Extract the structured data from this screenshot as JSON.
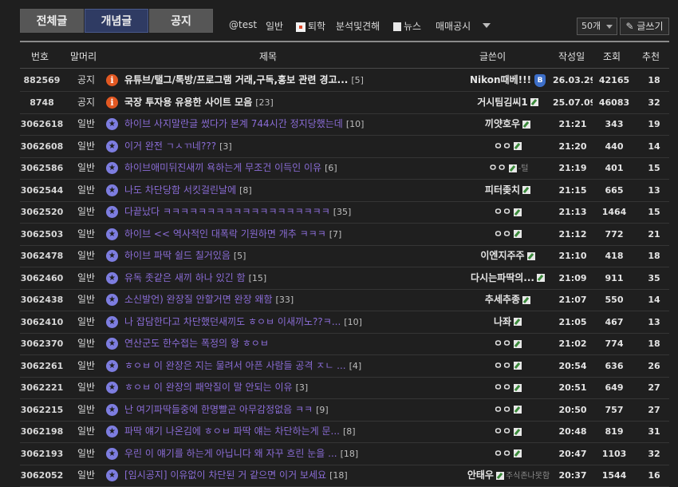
{
  "tabs": [
    {
      "label": "전체글"
    },
    {
      "label": "개념글"
    },
    {
      "label": "공지"
    }
  ],
  "categories": [
    {
      "label": "@test"
    },
    {
      "label": "일반"
    },
    {
      "label": "퇴학"
    },
    {
      "label": "분석및견해"
    },
    {
      "label": "뉴스"
    },
    {
      "label": "매매공시"
    }
  ],
  "page_size": {
    "value": "50개"
  },
  "write_button": {
    "label": "글쓰기"
  },
  "columns": {
    "num": "번호",
    "head": "말머리",
    "title": "제목",
    "writer": "글쓴이",
    "date": "작성일",
    "views": "조회",
    "rec": "추천"
  },
  "posts": [
    {
      "num": "882569",
      "head": "공지",
      "title": "유튜브/탤그/톡방/프로그램 거래,구독,홍보 관련 경고...",
      "count": "[5]",
      "writer": "Nikon때베!!!",
      "writer_sub": "",
      "date": "26.03.29",
      "views": "42165",
      "rec": "18",
      "notice": true
    },
    {
      "num": "8748",
      "head": "공지",
      "title": "국장 투자용 유용한 사이트 모음",
      "count": "[23]",
      "writer": "거시팀김씨1",
      "writer_sub": "",
      "date": "25.07.09",
      "views": "46083",
      "rec": "32",
      "notice": true
    },
    {
      "num": "3062618",
      "head": "일반",
      "title": "하이브 사지말란글 썼다가 본계 744시간 정지당했는데",
      "count": "[10]",
      "writer": "끼얏호우",
      "writer_sub": "",
      "date": "21:21",
      "views": "343",
      "rec": "19",
      "notice": false
    },
    {
      "num": "3062608",
      "head": "일반",
      "title": "이거 완전 ㄱㅅㄲ네???",
      "count": "[3]",
      "writer": "ㅇㅇ",
      "writer_sub": "",
      "date": "21:20",
      "views": "440",
      "rec": "14",
      "notice": false
    },
    {
      "num": "3062586",
      "head": "일반",
      "title": "하이브애미뒤진새끼 욕하는게 무조건 이득인 이유",
      "count": "[6]",
      "writer": "ㅇㅇ",
      "writer_sub": "-털",
      "date": "21:19",
      "views": "401",
      "rec": "15",
      "notice": false
    },
    {
      "num": "3062544",
      "head": "일반",
      "title": "나도 차단당함 서킷걸린날에",
      "count": "[8]",
      "writer": "피터좆치",
      "writer_sub": "",
      "date": "21:15",
      "views": "665",
      "rec": "13",
      "notice": false
    },
    {
      "num": "3062520",
      "head": "일반",
      "title": "다끝났다 ㅋㅋㅋㅋㅋㅋㅋㅋㅋㅋㅋㅋㅋㅋㅋㅋㅋㅋㅋ",
      "count": "[35]",
      "writer": "ㅇㅇ",
      "writer_sub": "",
      "date": "21:13",
      "views": "1464",
      "rec": "15",
      "notice": false
    },
    {
      "num": "3062503",
      "head": "일반",
      "title": "하이브 << 역사적인 대폭락 기원하면 개추 ㅋㅋㅋ",
      "count": "[7]",
      "writer": "ㅇㅇ",
      "writer_sub": "",
      "date": "21:12",
      "views": "772",
      "rec": "21",
      "notice": false
    },
    {
      "num": "3062478",
      "head": "일반",
      "title": "하이브 파딱 쉴드 칠거있음",
      "count": "[5]",
      "writer": "이엔지주주",
      "writer_sub": "",
      "date": "21:10",
      "views": "418",
      "rec": "18",
      "notice": false
    },
    {
      "num": "3062460",
      "head": "일반",
      "title": "유독 좃같은 새끼 하나 있긴 함",
      "count": "[15]",
      "writer": "다시는파딱의...",
      "writer_sub": "",
      "date": "21:09",
      "views": "911",
      "rec": "35",
      "notice": false
    },
    {
      "num": "3062438",
      "head": "일반",
      "title": "소신발언) 완장질 안할거면 완장 왜함",
      "count": "[33]",
      "writer": "추세추종",
      "writer_sub": "",
      "date": "21:07",
      "views": "550",
      "rec": "14",
      "notice": false
    },
    {
      "num": "3062410",
      "head": "일반",
      "title": "나 잡담한다고 차단했던새끼도 ㅎㅇㅂ 이새끼노??ㅋ...",
      "count": "[10]",
      "writer": "나좌",
      "writer_sub": "",
      "date": "21:05",
      "views": "467",
      "rec": "13",
      "notice": false
    },
    {
      "num": "3062370",
      "head": "일반",
      "title": "연산군도 한수접는 폭정의 왕 ㅎㅇㅂ",
      "count": "",
      "writer": "ㅇㅇ",
      "writer_sub": "",
      "date": "21:02",
      "views": "774",
      "rec": "18",
      "notice": false
    },
    {
      "num": "3062261",
      "head": "일반",
      "title": "ㅎㅇㅂ 이 완장은 지는 물려서 아픈 사람들 공격 ㅈㄴ ...",
      "count": "[4]",
      "writer": "ㅇㅇ",
      "writer_sub": "",
      "date": "20:54",
      "views": "636",
      "rec": "26",
      "notice": false
    },
    {
      "num": "3062221",
      "head": "일반",
      "title": "ㅎㅇㅂ 이 완장의 패악질이 말 안되는 이유",
      "count": "[3]",
      "writer": "ㅇㅇ",
      "writer_sub": "",
      "date": "20:51",
      "views": "649",
      "rec": "27",
      "notice": false
    },
    {
      "num": "3062215",
      "head": "일반",
      "title": "난 여기파딱들중에 한명빨곤 아무감정없음 ㅋㅋ",
      "count": "[9]",
      "writer": "ㅇㅇ",
      "writer_sub": "",
      "date": "20:50",
      "views": "757",
      "rec": "27",
      "notice": false
    },
    {
      "num": "3062198",
      "head": "일반",
      "title": "파딱 얘기 나온김에 ㅎㅇㅂ 파딱 얘는 차단하는게 문...",
      "count": "[8]",
      "writer": "ㅇㅇ",
      "writer_sub": "",
      "date": "20:48",
      "views": "819",
      "rec": "31",
      "notice": false
    },
    {
      "num": "3062193",
      "head": "일반",
      "title": "우린 이 얘기를 하는게 아닙니다 왜 자꾸 흐린 눈을 ...",
      "count": "[18]",
      "writer": "ㅇㅇ",
      "writer_sub": "",
      "date": "20:47",
      "views": "1103",
      "rec": "32",
      "notice": false
    },
    {
      "num": "3062052",
      "head": "일반",
      "title": "[임시공지] 이유없이 차단된 거 같으면 이거 보세요",
      "count": "[18]",
      "writer": "안태우",
      "writer_sub": "주식존나못함",
      "date": "20:37",
      "views": "1544",
      "rec": "16",
      "notice": false
    }
  ]
}
